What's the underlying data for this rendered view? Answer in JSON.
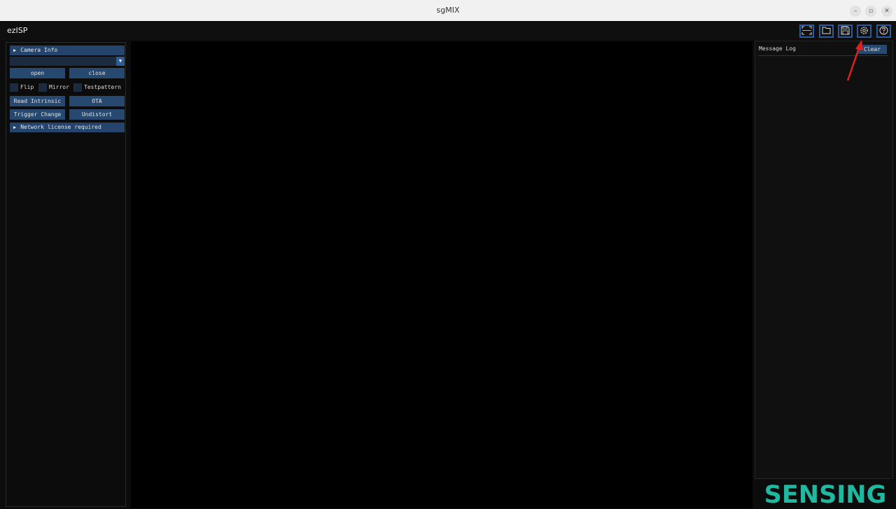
{
  "window": {
    "title": "sgMIX"
  },
  "app": {
    "name": "ezISP"
  },
  "toolbar": {
    "icons": [
      "fit-view-icon",
      "folder-icon",
      "save-icon",
      "settings-icon",
      "help-icon"
    ]
  },
  "left_panel": {
    "camera_info_label": "Camera Info",
    "camera_select_value": "",
    "open_label": "open",
    "close_label": "close",
    "flip_label": "Flip",
    "mirror_label": "Mirror",
    "testpattern_label": "Testpattern",
    "read_intrinsic_label": "Read Intrinsic",
    "ota_label": "OTA",
    "trigger_change_label": "Trigger Change",
    "undistort_label": "Undistort",
    "network_license_label": "Network license required"
  },
  "message_log": {
    "title": "Message Log",
    "clear_label": "Clear"
  },
  "logo": {
    "text": "SENSING"
  },
  "colors": {
    "accent": "#27486f",
    "header": "#25446b",
    "annotation": "#e0201e",
    "logo": "#1fb8a0"
  }
}
